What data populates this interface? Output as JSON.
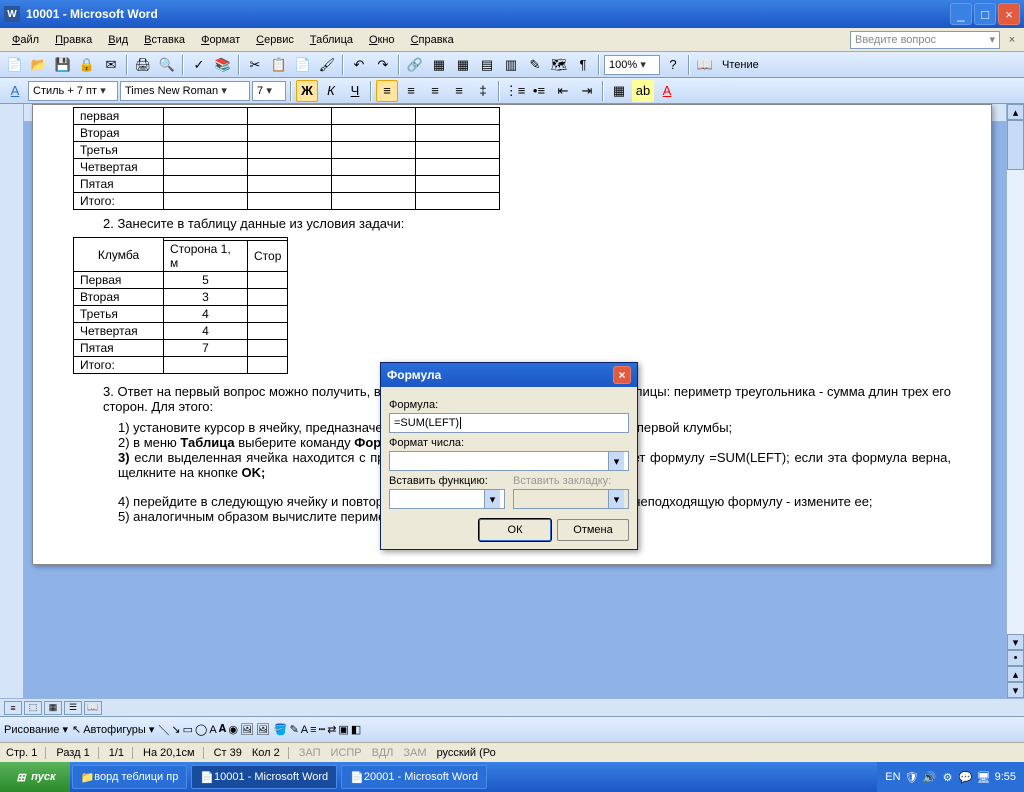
{
  "titlebar": {
    "title": "10001 - Microsoft Word"
  },
  "menubar": {
    "items": [
      "Файл",
      "Правка",
      "Вид",
      "Вставка",
      "Формат",
      "Сервис",
      "Таблица",
      "Окно",
      "Справка"
    ],
    "ask": "Введите вопрос"
  },
  "toolbar": {
    "zoom": "100%",
    "reading": "Чтение"
  },
  "fmtbar": {
    "style": "Стиль + 7 пт",
    "font": "Times New Roman",
    "size": "7",
    "bold": "Ж",
    "ital": "К",
    "uline": "Ч"
  },
  "doc": {
    "table1_rows": [
      "первая",
      "Вторая",
      "Третья",
      "Четвертая",
      "Пятая",
      "Итого:"
    ],
    "step2": "2. Занесите в таблицу данные из условия задачи:",
    "table2": {
      "header1": "Клумба",
      "header2": "Сторона 1, м",
      "header3": "Стор",
      "rows": [
        {
          "name": "Первая",
          "v": "5"
        },
        {
          "name": "Вторая",
          "v": "3"
        },
        {
          "name": "Третья",
          "v": "4"
        },
        {
          "name": "Четвертая",
          "v": "4"
        },
        {
          "name": "Пятая",
          "v": "7"
        },
        {
          "name": "Итого:",
          "v": ""
        }
      ]
    },
    "step3a": "3. Ответ на первый вопрос можно получить, вычислив значение в последней графе таблицы: периметр треугольника - сумма длин трех его сторон. Для этого:",
    "step3_1": "1) установите курсор в ячейку, предназначенную для занесения значения периметра первой клумбы;",
    "step3_2a": "2) в меню ",
    "step3_2b": "Таблица",
    "step3_2c": " выберите команду ",
    "step3_2d": "Формула;",
    "step3_3a": "3) ",
    "step3_3b": "если выделенная ячейка находится с правого края строки чисел, Word предлагает формулу =SUM(LEFT); если эта формула верна, щелкните на кнопке ",
    "step3_3c": "OK;",
    "step3_4": "4) перейдите в следующую ячейку и повторите действия п. 2; если Word предлагает неподходящую формулу - измените ее;",
    "step3_5": "5) аналогичным образом вычислите периметр остальных Тре- угольников."
  },
  "dialog": {
    "title": "Формула",
    "formula_label": "Формула:",
    "formula_value": "=SUM(LEFT)",
    "numfmt_label": "Формат числа:",
    "insfn_label": "Вставить функцию:",
    "insbk_label": "Вставить закладку:",
    "ok": "ОК",
    "cancel": "Отмена"
  },
  "drawbar": {
    "drawing": "Рисование",
    "autoshapes": "Автофигуры"
  },
  "status": {
    "page": "Стр. 1",
    "section": "Разд 1",
    "pages": "1/1",
    "pos": "На 20,1см",
    "line": "Ст 39",
    "col": "Кол 2",
    "zap": "ЗАП",
    "isp": "ИСПР",
    "vdl": "ВДЛ",
    "zam": "ЗАМ",
    "lang": "русский (Ро"
  },
  "taskbar": {
    "start": "пуск",
    "items": [
      "ворд теблици пр",
      "10001 - Microsoft Word",
      "20001 - Microsoft Word"
    ],
    "lang": "EN",
    "time": "9:55"
  }
}
